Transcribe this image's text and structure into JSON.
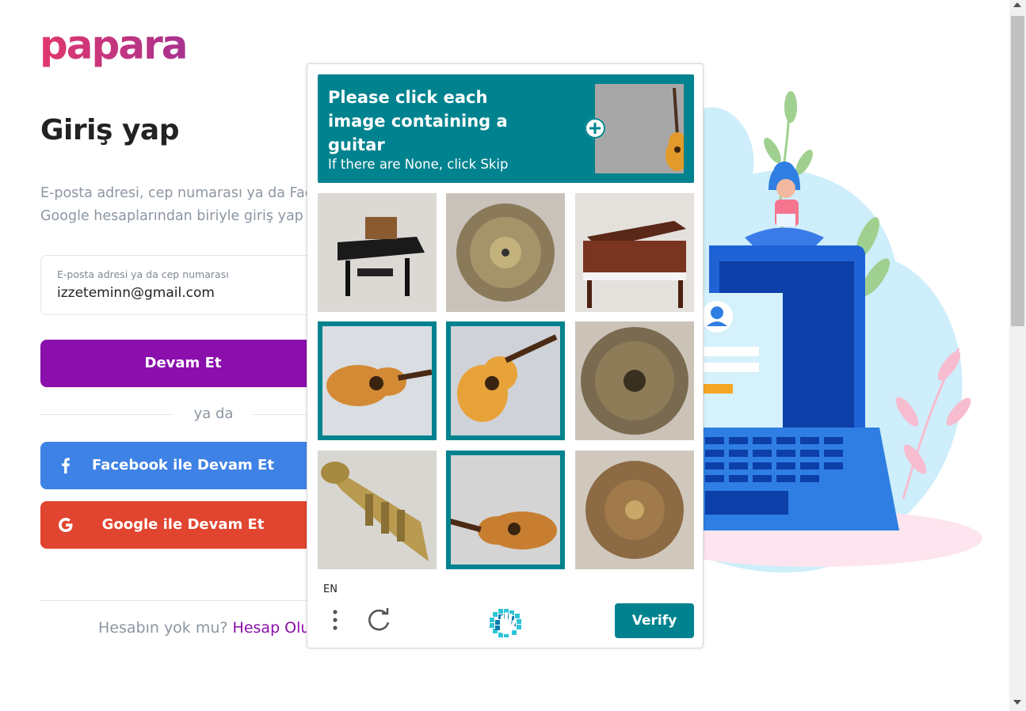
{
  "brand": {
    "logo_text": "papara",
    "colors": {
      "purple": "#8a0fab",
      "facebook": "#3f82e6",
      "google": "#e1442f",
      "captcha_teal": "#00838f"
    }
  },
  "login": {
    "title": "Giriş yap",
    "subtitle_line1": "E-posta adresi, cep numarası ya da Facebook,",
    "subtitle_line2": "Google hesaplarından biriyle giriş yap",
    "email_label": "E-posta adresi ya da cep numarası",
    "email_value": "izzeteminn@gmail.com",
    "continue_button": "Devam Et",
    "or_text": "ya da",
    "facebook_button": "Facebook ile Devam Et",
    "google_button": "Google ile Devam Et",
    "signup_question": "Hesabın yok mu?",
    "signup_link": "Hesap Oluştur"
  },
  "captcha": {
    "prompt": "Please click each image containing a guitar",
    "hint": "If there are None, click Skip",
    "language": "EN",
    "verify_button": "Verify",
    "icons": {
      "menu": "more-vertical-icon",
      "refresh": "refresh-icon",
      "logo": "hcaptcha-hand-icon",
      "expand": "plus-circle-icon"
    },
    "tiles": [
      {
        "content": "grand piano",
        "selected": false
      },
      {
        "content": "cymbal",
        "selected": false
      },
      {
        "content": "upright piano",
        "selected": false
      },
      {
        "content": "acoustic guitar",
        "selected": true
      },
      {
        "content": "acoustic guitar",
        "selected": true
      },
      {
        "content": "cymbal",
        "selected": false
      },
      {
        "content": "trumpet",
        "selected": false
      },
      {
        "content": "acoustic guitar",
        "selected": true
      },
      {
        "content": "cymbal",
        "selected": false
      }
    ]
  }
}
